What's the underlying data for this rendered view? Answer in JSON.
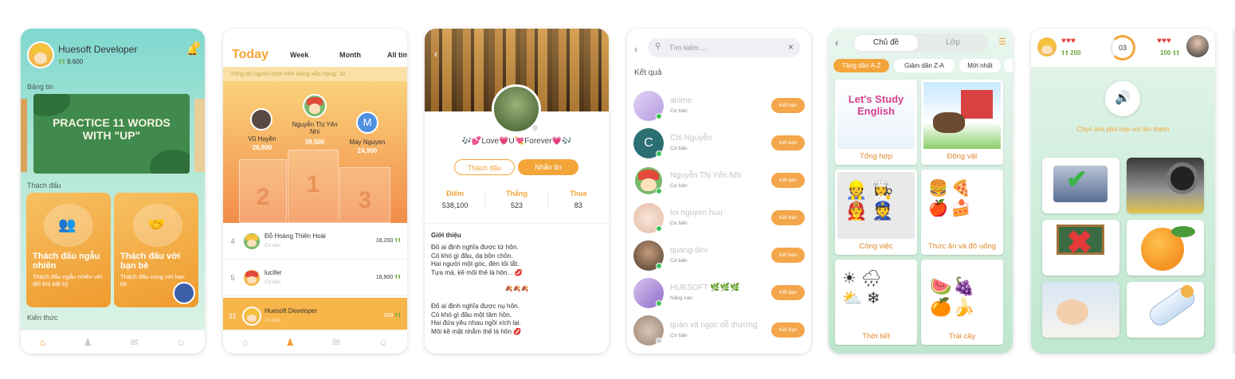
{
  "home": {
    "user": "Huesoft Developer",
    "coins": "9,600",
    "badge": "1",
    "news_label": "Bảng tin",
    "banner": "PRACTICE 11 WORDS WITH \"UP\"",
    "challenge_label": "Thách đấu",
    "card1_title": "Thách đấu ngẫu nhiên",
    "card1_desc": "Thách đấu ngẫu nhiên với đối thủ bất kỳ",
    "card2_title": "Thách đấu với bạn bè",
    "card2_desc": "Thách đấu cùng với bạn bè",
    "knowledge_label": "Kiến thức",
    "nav": [
      "⌂",
      "♟",
      "✉",
      "☺"
    ]
  },
  "rank": {
    "tabs": [
      "Today",
      "Week",
      "Month",
      "All tim"
    ],
    "notice": "Tổng số người chơi trên bảng xếp hạng: 32",
    "first": {
      "name": "Nguyễn Thị Yến Nhi",
      "score": "39,500",
      "place": "1"
    },
    "second": {
      "name": "Vũ Huyền",
      "score": "26,900",
      "place": "2"
    },
    "third": {
      "name": "May Nguyen",
      "score": "24,900",
      "place": "3",
      "initial": "M"
    },
    "rows": [
      {
        "pos": "4",
        "name": "Đỗ Hoàng Thiên Hoài",
        "level": "Cơ bản",
        "score": "18,200"
      },
      {
        "pos": "5",
        "name": "lucifer",
        "level": "Cơ bản",
        "score": "16,900"
      }
    ],
    "me": {
      "pos": "31",
      "name": "Huesoft Developer",
      "level": "Cơ bản",
      "score": "300"
    }
  },
  "profile": {
    "name": "🎶💕Love💗U💘Forever💗🎶",
    "btn_challenge": "Thách đấu",
    "btn_message": "Nhắn tin",
    "stats": [
      {
        "label": "Điểm",
        "value": "538,100"
      },
      {
        "label": "Thắng",
        "value": "523"
      },
      {
        "label": "Thua",
        "value": "83"
      }
    ],
    "intro_label": "Giới thiệu",
    "poem1": [
      "Đố ai định nghĩa được từ hôn.",
      "Có khó gì đâu, dạ bồn chồn.",
      "Hai người một góc, đèn tối tắt.",
      "Tựa má, kề môi thế là hôn... 💋"
    ],
    "divider": "🍂🍂🍂",
    "poem2": [
      "Đố ai định nghĩa được nụ hôn.",
      "Có khó gì đâu một tâm hồn.",
      "Hai đứa yêu nhau ngồi xích lại.",
      "Môi kề mặt nhắm thế là hôn 💋"
    ]
  },
  "search": {
    "placeholder": "Tìm kiếm ...",
    "results_label": "Kết quả",
    "button": "Kết bạn",
    "people": [
      {
        "name": "anime",
        "level": "Cơ bản",
        "color": "#c9a6e6"
      },
      {
        "name": "Chi Nguyễn",
        "level": "Cơ bản",
        "color": "#2b6f73",
        "initial": "C"
      },
      {
        "name": "Nguyễn Thị Yến Nhi",
        "level": "Cơ bản",
        "color": "#f5b24a"
      },
      {
        "name": "toi nguyen huu",
        "level": "Cơ bản",
        "color": "#f0d6c8"
      },
      {
        "name": "quang-dev",
        "level": "Cơ bản",
        "color": "#6a5a44"
      },
      {
        "name": "HUESOFT 🌿🌿🌿",
        "level": "Nâng cao",
        "color": "#a88bd6"
      },
      {
        "name": "quân và ngọc dễ thương",
        "level": "Cơ bản",
        "color": "#b9a291"
      }
    ]
  },
  "topics": {
    "tabs": [
      "Chủ đề",
      "Lớp"
    ],
    "chips": [
      "Tăng dần A-Z",
      "Giảm dần Z-A",
      "Mới nhất"
    ],
    "tiles": [
      "Tổng hợp",
      "Động vật",
      "Công việc",
      "Thức ăn và đồ uống",
      "Thời tiết",
      "Trái cây"
    ],
    "tile1_art": "Let's Study English"
  },
  "game": {
    "my_score": "200",
    "their_score": "100",
    "timer": "03",
    "hearts_me": "♥♥♥",
    "hearts_them": "♥♥♥",
    "prompt": "Chọn ảnh phù hợp với âm thanh"
  }
}
